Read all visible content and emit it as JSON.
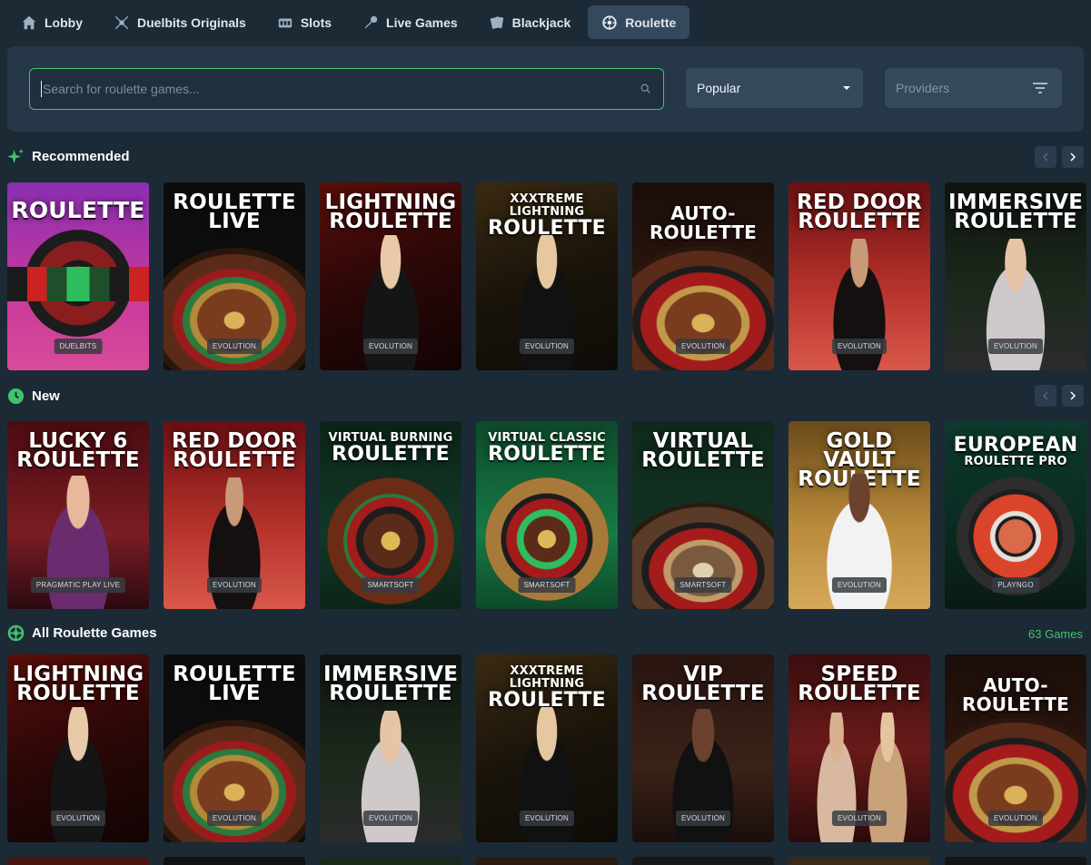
{
  "nav": {
    "tabs": [
      {
        "label": "Lobby",
        "icon": "home-icon"
      },
      {
        "label": "Duelbits Originals",
        "icon": "swords-icon"
      },
      {
        "label": "Slots",
        "icon": "slot-machine-icon"
      },
      {
        "label": "Live Games",
        "icon": "microphone-icon"
      },
      {
        "label": "Blackjack",
        "icon": "cards-icon"
      },
      {
        "label": "Roulette",
        "icon": "roulette-icon"
      }
    ],
    "active": "Roulette"
  },
  "search": {
    "placeholder": "Search for roulette games..."
  },
  "sort": {
    "selected": "Popular"
  },
  "providers": {
    "label": "Providers"
  },
  "sections": {
    "recommended": {
      "title": "Recommended"
    },
    "new": {
      "title": "New"
    },
    "all": {
      "title": "All Roulette Games",
      "count": "63 Games"
    }
  },
  "recommended_games": [
    {
      "title": "ROULETTE",
      "provider": "DUELBITS"
    },
    {
      "title": "ROULETTE LIVE",
      "provider": "EVOLUTION"
    },
    {
      "title": "LIGHTNING ROULETTE",
      "provider": "EVOLUTION"
    },
    {
      "title_small": "XXXTREME LIGHTNING",
      "title": "ROULETTE",
      "provider": "EVOLUTION"
    },
    {
      "title": "AUTO-ROULETTE",
      "provider": "EVOLUTION"
    },
    {
      "title": "RED DOOR ROULETTE",
      "provider": "EVOLUTION"
    },
    {
      "title": "IMMERSIVE ROULETTE",
      "provider": "EVOLUTION"
    }
  ],
  "new_games": [
    {
      "title": "LUCKY 6 ROULETTE",
      "provider": "PRAGMATIC PLAY LIVE"
    },
    {
      "title": "RED DOOR ROULETTE",
      "provider": "EVOLUTION"
    },
    {
      "title_small": "VIRTUAL BURNING",
      "title": "ROULETTE",
      "provider": "SMARTSOFT"
    },
    {
      "title_small": "VIRTUAL CLASSIC",
      "title": "ROULETTE",
      "provider": "SMARTSOFT"
    },
    {
      "title": "VIRTUAL ROULETTE",
      "provider": "SMARTSOFT"
    },
    {
      "title": "GOLD VAULT ROULETTE",
      "provider": "EVOLUTION"
    },
    {
      "title": "EUROPEAN",
      "title_small_after": "ROULETTE PRO",
      "provider": "PLAYNGO"
    }
  ],
  "all_games": [
    {
      "title": "LIGHTNING ROULETTE",
      "provider": "EVOLUTION"
    },
    {
      "title": "ROULETTE LIVE",
      "provider": "EVOLUTION"
    },
    {
      "title": "IMMERSIVE ROULETTE",
      "provider": "EVOLUTION"
    },
    {
      "title_small": "XXXTREME LIGHTNING",
      "title": "ROULETTE",
      "provider": "EVOLUTION"
    },
    {
      "title": "VIP ROULETTE",
      "provider": "EVOLUTION"
    },
    {
      "title": "SPEED ROULETTE",
      "provider": "EVOLUTION"
    },
    {
      "title": "AUTO-ROULETTE",
      "provider": "EVOLUTION"
    }
  ],
  "colors": {
    "accent": "#3ec46d",
    "background": "#1c2a36",
    "panel": "#263847",
    "control": "#34495c"
  }
}
